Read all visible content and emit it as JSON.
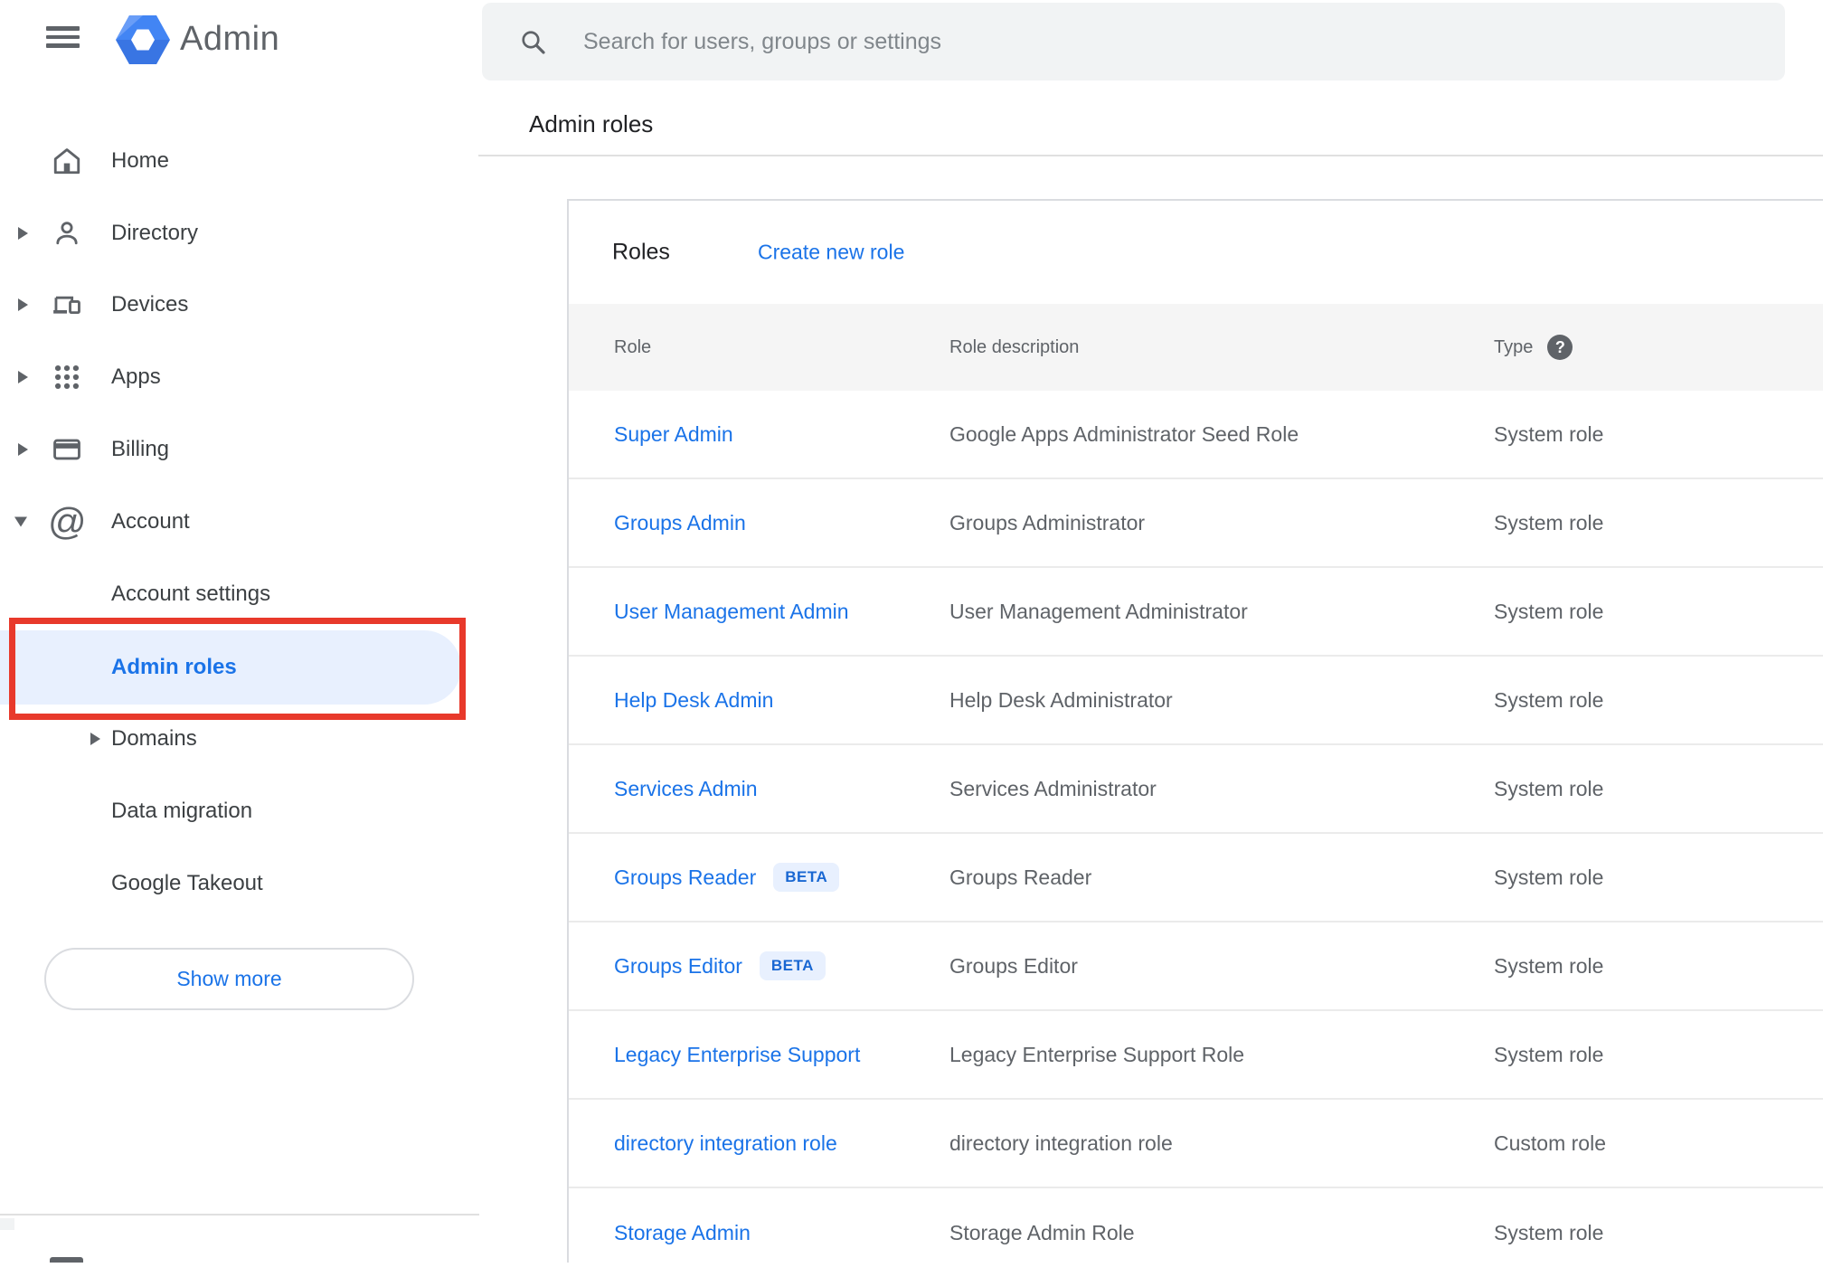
{
  "topbar": {
    "product": "Admin",
    "search_placeholder": "Search for users, groups or settings"
  },
  "breadcrumb": "Admin roles",
  "sidebar": {
    "items": [
      {
        "label": "Home"
      },
      {
        "label": "Directory"
      },
      {
        "label": "Devices"
      },
      {
        "label": "Apps"
      },
      {
        "label": "Billing"
      },
      {
        "label": "Account"
      },
      {
        "label": "Account settings"
      },
      {
        "label": "Admin roles",
        "selected": true
      },
      {
        "label": "Domains"
      },
      {
        "label": "Data migration"
      },
      {
        "label": "Google Takeout"
      }
    ],
    "show_more": "Show more"
  },
  "panel": {
    "title": "Roles",
    "create_link": "Create new role",
    "columns": {
      "role": "Role",
      "description": "Role description",
      "type": "Type"
    },
    "help_glyph": "?",
    "rows": [
      {
        "role": "Super Admin",
        "beta": "",
        "description": "Google Apps Administrator Seed Role",
        "type": "System role"
      },
      {
        "role": "Groups Admin",
        "beta": "",
        "description": "Groups Administrator",
        "type": "System role"
      },
      {
        "role": "User Management Admin",
        "beta": "",
        "description": "User Management Administrator",
        "type": "System role"
      },
      {
        "role": "Help Desk Admin",
        "beta": "",
        "description": "Help Desk Administrator",
        "type": "System role"
      },
      {
        "role": "Services Admin",
        "beta": "",
        "description": "Services Administrator",
        "type": "System role"
      },
      {
        "role": "Groups Reader",
        "beta": "BETA",
        "description": "Groups Reader",
        "type": "System role"
      },
      {
        "role": "Groups Editor",
        "beta": "BETA",
        "description": "Groups Editor",
        "type": "System role"
      },
      {
        "role": "Legacy Enterprise Support",
        "beta": "",
        "description": "Legacy Enterprise Support Role",
        "type": "System role"
      },
      {
        "role": "directory integration role",
        "beta": "",
        "description": "directory integration role",
        "type": "Custom role"
      },
      {
        "role": "Storage Admin",
        "beta": "",
        "description": "Storage Admin Role",
        "type": "System role"
      }
    ]
  },
  "icons": {
    "at_glyph": "@"
  },
  "colors": {
    "link_blue": "#1a73e8",
    "beta_text": "#1967d2",
    "beta_bg": "#e8f0fe",
    "selected_bg": "#e8f0fe",
    "annotation_red": "#e8392b",
    "icon_gray": "#5f6368",
    "table_header_bg": "#f5f5f5",
    "search_bg": "#f1f3f4"
  }
}
